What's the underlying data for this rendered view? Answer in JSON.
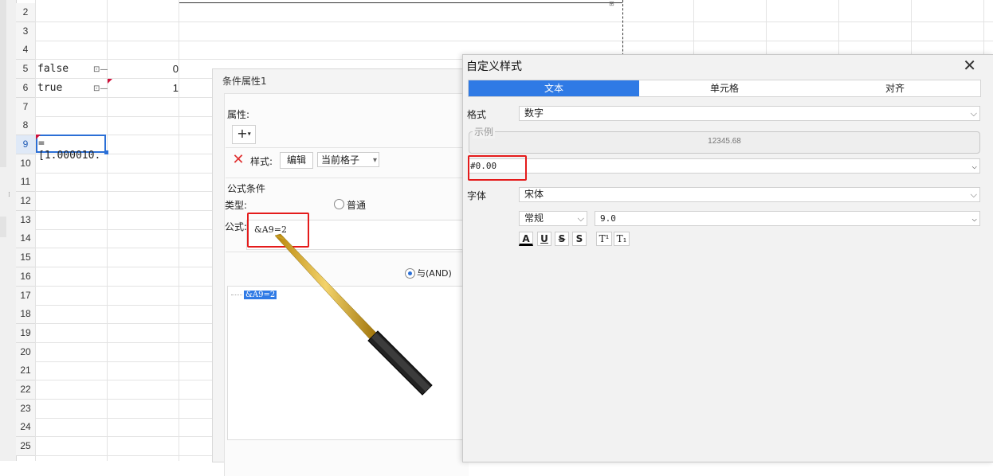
{
  "sheet": {
    "row_numbers": [
      "2",
      "3",
      "4",
      "5",
      "6",
      "7",
      "8",
      "9",
      "10",
      "11",
      "12",
      "13",
      "14",
      "15",
      "16",
      "17",
      "18",
      "19",
      "20",
      "21",
      "22",
      "23",
      "24",
      "25"
    ],
    "cells": {
      "a5": "false",
      "b5": "0",
      "a6": "true",
      "b6": "1",
      "a9": "=[1.000010."
    }
  },
  "condition_dialog": {
    "title": "条件属性1",
    "attr_label": "属性:",
    "add_button": "+",
    "style_label": "样式:",
    "edit_button": "编辑",
    "scope_select": "当前格子",
    "formula_section": "公式条件",
    "type_label": "类型:",
    "type_option_normal": "普通",
    "formula_label": "公式:",
    "formula_value": "&A9=2",
    "and_option": "与(AND)",
    "tree_item": "&A9=2"
  },
  "custom_style_dialog": {
    "title": "自定义样式",
    "close_icon": "close-icon",
    "tabs": [
      "文本",
      "单元格",
      "对齐"
    ],
    "active_tab": 0,
    "format_label": "格式",
    "format_value": "数字",
    "sample_label": "示例",
    "sample_value": "12345.68",
    "pattern_value": "#0.00",
    "font_label": "字体",
    "font_value": "宋体",
    "font_style": "常规",
    "font_size": "9.0",
    "format_buttons": [
      "A",
      "U",
      "S",
      "S",
      "T¹",
      "T₁"
    ]
  },
  "colors": {
    "accent": "#2f7ae5",
    "highlight_red": "#e41b1b"
  }
}
